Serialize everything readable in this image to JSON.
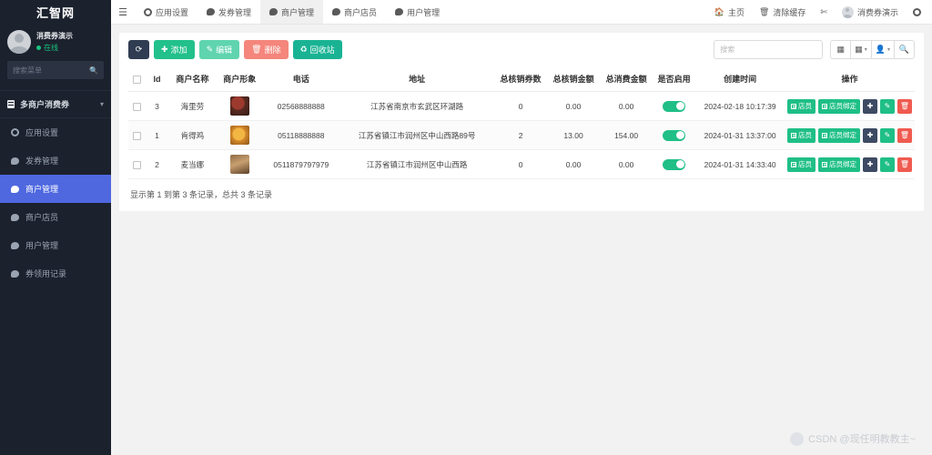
{
  "sidebar": {
    "brand": "汇智网",
    "user": {
      "name": "消费券演示",
      "status": "在线"
    },
    "search_placeholder": "搜索菜单",
    "group": {
      "label": "多商户消费券",
      "icon": "book-icon",
      "chevron": "chevron-down-icon"
    },
    "items": [
      {
        "label": "应用设置",
        "icon": "gear-icon",
        "active": false
      },
      {
        "label": "发券管理",
        "icon": "chat-icon",
        "active": false
      },
      {
        "label": "商户管理",
        "icon": "chat-icon",
        "active": true
      },
      {
        "label": "商户店员",
        "icon": "chat-icon",
        "active": false
      },
      {
        "label": "用户管理",
        "icon": "chat-icon",
        "active": false
      },
      {
        "label": "券领用记录",
        "icon": "chat-icon",
        "active": false
      }
    ],
    "active_color": "#4f68e0",
    "bg_color": "#1b212d"
  },
  "topbar": {
    "menu_icon": "hamburger-icon",
    "tabs": [
      {
        "label": "应用设置",
        "icon": "gear-icon",
        "active": false
      },
      {
        "label": "发券管理",
        "icon": "chat-icon",
        "active": false
      },
      {
        "label": "商户管理",
        "icon": "chat-icon",
        "active": true
      },
      {
        "label": "商户店员",
        "icon": "chat-icon",
        "active": false
      },
      {
        "label": "用户管理",
        "icon": "chat-icon",
        "active": false
      }
    ],
    "right": {
      "home": "主页",
      "clear_cache": "清除缓存",
      "fullscreen_icon": "fullscreen-icon",
      "user": "消费券演示",
      "settings_icon": "gear-icon"
    }
  },
  "toolbar": {
    "refresh_icon": "refresh-icon",
    "add": "添加",
    "edit": "编辑",
    "delete": "删除",
    "recycle": "回收站",
    "search_placeholder": "搜索",
    "icons": [
      "columns-icon",
      "grid-icon",
      "person-icon",
      "search-icon"
    ],
    "colors": {
      "refresh": "#2f3c52",
      "add": "#22c08b",
      "edit": "#5fd4ae",
      "delete": "#f4867c",
      "recycle": "#19b394"
    }
  },
  "table": {
    "headers": [
      "",
      "Id",
      "商户名称",
      "商户形象",
      "电话",
      "地址",
      "总核销券数",
      "总核销金额",
      "总消费金额",
      "是否启用",
      "创建时间",
      "操作"
    ],
    "rows": [
      {
        "id": "3",
        "name": "海里劳",
        "image": "merchant-photo-1",
        "phone": "02568888888",
        "address": "江苏省南京市玄武区环湖路",
        "verified_count": "0",
        "verified_amount": "0.00",
        "consume_amount": "0.00",
        "enabled": true,
        "created": "2024-02-18 10:17:39"
      },
      {
        "id": "1",
        "name": "肯得鸡",
        "image": "merchant-photo-2",
        "phone": "05118888888",
        "address": "江苏省镇江市润州区中山西路89号",
        "verified_count": "2",
        "verified_amount": "13.00",
        "consume_amount": "154.00",
        "enabled": true,
        "created": "2024-01-31 13:37:00"
      },
      {
        "id": "2",
        "name": "麦当娜",
        "image": "merchant-photo-3",
        "phone": "0511879797979",
        "address": "江苏省镇江市润州区中山西路",
        "verified_count": "0",
        "verified_amount": "0.00",
        "consume_amount": "0.00",
        "enabled": true,
        "created": "2024-01-31 14:33:40"
      }
    ],
    "actions": {
      "staff": "店员",
      "staff_bind": "店员绑定",
      "move_icon": "move-icon",
      "edit_icon": "pencil-icon",
      "delete_icon": "trash-icon"
    },
    "footer": "显示第 1 到第 3 条记录，总共 3 条记录"
  },
  "watermark": "CSDN @现任明教教主~"
}
